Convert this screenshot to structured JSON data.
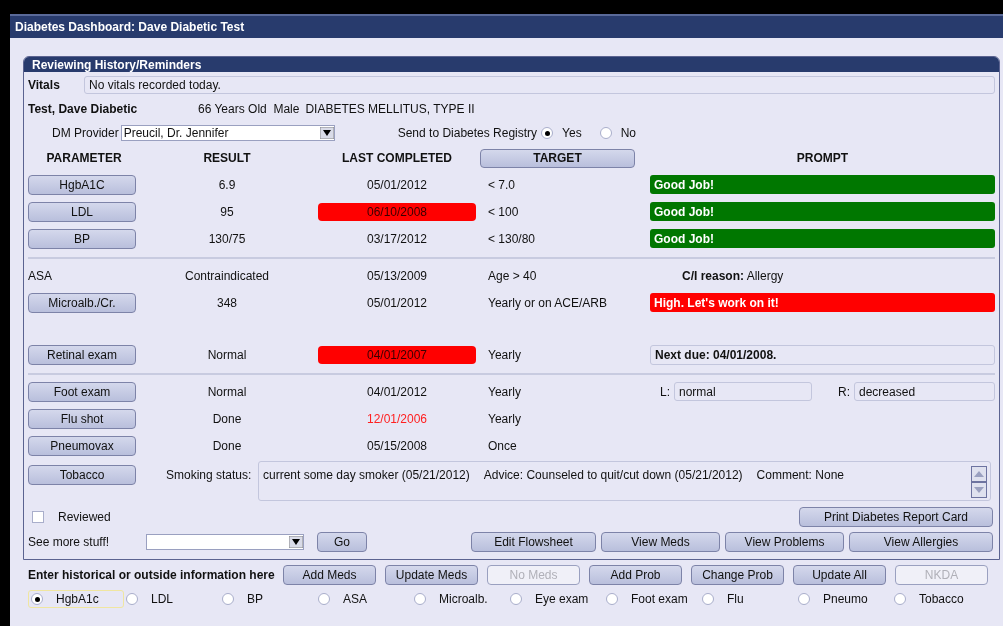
{
  "window": {
    "title": "Diabetes Dashboard:  Dave Diabetic Test"
  },
  "panel": {
    "title": "Reviewing History/Reminders"
  },
  "vitals": {
    "label": "Vitals",
    "value": "No vitals recorded today."
  },
  "patient": {
    "name": "Test, Dave Diabetic",
    "age_sex": "66 Years Old  Male",
    "diagnosis": "DIABETES MELLITUS, TYPE II"
  },
  "provider": {
    "label": "DM Provider",
    "value": "Preucil, Dr. Jennifer"
  },
  "registry": {
    "label": "Send to Diabetes Registry",
    "options": [
      {
        "label": "Yes",
        "selected": true
      },
      {
        "label": "No",
        "selected": false
      }
    ]
  },
  "columns": [
    {
      "label": "PARAMETER",
      "kind": "text"
    },
    {
      "label": "RESULT",
      "kind": "text"
    },
    {
      "label": "LAST COMPLETED",
      "kind": "text"
    },
    {
      "label": "TARGET",
      "kind": "button"
    },
    {
      "label": "PROMPT",
      "kind": "text"
    }
  ],
  "sections": [
    [
      {
        "parameter": "HgbA1C",
        "kind": "button",
        "result": "6.9",
        "last_completed": "05/01/2012",
        "overdue": false,
        "late": false,
        "target": "< 7.0",
        "prompt": {
          "kind": "good",
          "text": "Good Job!"
        }
      },
      {
        "parameter": "LDL",
        "kind": "button",
        "result": "95",
        "last_completed": "06/10/2008",
        "overdue": true,
        "late": false,
        "target": "< 100",
        "prompt": {
          "kind": "good",
          "text": "Good Job!"
        }
      },
      {
        "parameter": "BP",
        "kind": "button",
        "result": "130/75",
        "last_completed": "03/17/2012",
        "overdue": false,
        "late": false,
        "target": "< 130/80",
        "prompt": {
          "kind": "good",
          "text": "Good Job!"
        }
      }
    ],
    [
      {
        "parameter": "ASA",
        "kind": "text",
        "result": "Contraindicated",
        "last_completed": "05/13/2009",
        "overdue": false,
        "late": false,
        "target": "Age > 40",
        "prompt": {
          "kind": "reason",
          "label": "C/I reason:",
          "text": "Allergy"
        }
      },
      {
        "parameter": "Microalb./Cr.",
        "kind": "button",
        "result": "348",
        "last_completed": "05/01/2012",
        "overdue": false,
        "late": false,
        "target": "Yearly or on ACE/ARB",
        "prompt": {
          "kind": "alert",
          "text": "High.  Let's work on it!"
        }
      },
      {
        "parameter": "Retinal exam",
        "kind": "button",
        "gap_before": true,
        "result": "Normal",
        "last_completed": "04/01/2007",
        "overdue": true,
        "late": false,
        "target": "Yearly",
        "prompt": {
          "kind": "note",
          "text": "Next due: 04/01/2008."
        }
      }
    ],
    [
      {
        "parameter": "Foot exam",
        "kind": "button",
        "result": "Normal",
        "last_completed": "04/01/2012",
        "overdue": false,
        "late": false,
        "target": "Yearly",
        "prompt": {
          "kind": "sides",
          "left_label": "L:",
          "left": "normal",
          "right_label": "R:",
          "right": "decreased"
        }
      },
      {
        "parameter": "Flu shot",
        "kind": "button",
        "result": "Done",
        "last_completed": "12/01/2006",
        "overdue": false,
        "late": true,
        "target": "Yearly"
      },
      {
        "parameter": "Pneumovax",
        "kind": "button",
        "result": "Done",
        "last_completed": "05/15/2008",
        "overdue": false,
        "late": false,
        "target": "Once"
      }
    ]
  ],
  "tobacco": {
    "parameter": "Tobacco",
    "label": "Smoking status:",
    "status": "current some day smoker (05/21/2012)",
    "advice": "Advice: Counseled to quit/cut down (05/21/2012)",
    "comment": "Comment: None"
  },
  "reviewed": {
    "label": "Reviewed",
    "checked": false
  },
  "print_button": "Print Diabetes Report Card",
  "see_more": {
    "label": "See more stuff!",
    "go": "Go"
  },
  "view_buttons": [
    "Edit Flowsheet",
    "View Meds",
    "View Problems",
    "View Allergies"
  ],
  "entry": {
    "label": "Enter historical or outside information here",
    "buttons": [
      {
        "label": "Add Meds",
        "disabled": false
      },
      {
        "label": "Update Meds",
        "disabled": false
      },
      {
        "label": "No Meds",
        "disabled": true
      },
      {
        "label": "Add Prob",
        "disabled": false
      },
      {
        "label": "Change Prob",
        "disabled": false
      },
      {
        "label": "Update All",
        "disabled": false
      },
      {
        "label": "NKDA",
        "disabled": true
      }
    ]
  },
  "entry_options": [
    {
      "label": "HgbA1c",
      "selected": true
    },
    {
      "label": "LDL",
      "selected": false
    },
    {
      "label": "BP",
      "selected": false
    },
    {
      "label": "ASA",
      "selected": false
    },
    {
      "label": "Microalb.",
      "selected": false
    },
    {
      "label": "Eye exam",
      "selected": false
    },
    {
      "label": "Foot exam",
      "selected": false
    },
    {
      "label": "Flu",
      "selected": false
    },
    {
      "label": "Pneumo",
      "selected": false
    },
    {
      "label": "Tobacco",
      "selected": false
    }
  ]
}
